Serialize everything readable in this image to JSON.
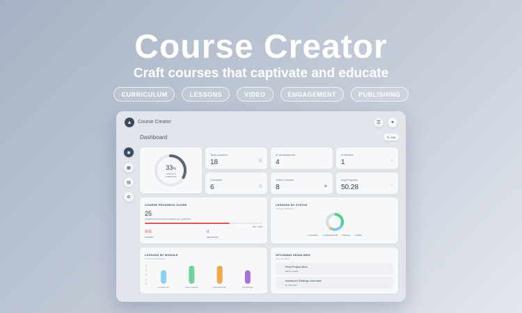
{
  "hero": {
    "title": "Course Creator",
    "subtitle": "Craft courses that captivate and educate",
    "pills": [
      "CURRICULUM",
      "LESSONS",
      "VIDEO",
      "ENGAGEMENT",
      "PUBLISHING"
    ]
  },
  "app": {
    "title": "Course Creator",
    "page_title": "Dashboard",
    "edit_label": "Edit"
  },
  "sidebar": {
    "items": [
      {
        "icon": "dashboard-icon",
        "active": true
      },
      {
        "icon": "calendar-icon",
        "active": false
      },
      {
        "icon": "calendar-grid-icon",
        "active": false
      },
      {
        "icon": "gear-icon",
        "active": false
      }
    ]
  },
  "completion": {
    "percent_display": "33",
    "percent_sign": "%",
    "label_line1": "LESSONS",
    "label_line2": "COMPLETE",
    "value": 0.33
  },
  "stats": [
    {
      "label": "Total Lessons",
      "value": "18",
      "icon": "list-icon"
    },
    {
      "label": "In Development",
      "value": "4",
      "icon": "spinner-icon"
    },
    {
      "label": "In Review",
      "value": "1",
      "icon": "search-icon"
    },
    {
      "label": "Complete",
      "value": "6",
      "icon": "check-circle-icon"
    },
    {
      "label": "Video Lessons",
      "value": "8",
      "icon": "video-icon"
    },
    {
      "label": "Avg Progress",
      "value": "50.28",
      "icon": "chart-icon"
    }
  ],
  "progress": {
    "title": "COURSE PROGRESS SCORE",
    "score": "25",
    "caption": "COMPLETION POINTS ACROSS ALL LESSONS",
    "target_label": "905 / 1250",
    "fill": 0.72,
    "earned_value": "905",
    "earned_label": "EARNED",
    "remaining_value": "0",
    "remaining_label": "REMAINING"
  },
  "status": {
    "title": "LESSONS BY STATUS",
    "subtitle": "Progress distribution",
    "legend": [
      {
        "label": "Complete",
        "color": "#4ccf8a",
        "value": 6
      },
      {
        "label": "In Development",
        "color": "#7cc7f0",
        "value": 4
      },
      {
        "label": "Review",
        "color": "#f2b84b",
        "value": 1
      },
      {
        "label": "Outline",
        "color": "#d7dbe2",
        "value": 7
      }
    ]
  },
  "modules": {
    "title": "LESSONS BY MODULE",
    "subtitle": "Curriculum breakdown",
    "y_ticks": [
      "4",
      "3",
      "2",
      "1",
      "0"
    ],
    "bars": [
      {
        "label": "Course Intro",
        "color": "#8ccff2",
        "value": 3
      },
      {
        "label": "Core Content",
        "color": "#6fd39a",
        "value": 4
      },
      {
        "label": "Advanced Top",
        "color": "#f2a64a",
        "value": 4
      },
      {
        "label": "Final Projec",
        "color": "#a873d6",
        "value": 3
      }
    ]
  },
  "deadlines": {
    "title": "UPCOMING DEADLINES",
    "subtitle": "Next due dates",
    "items": [
      {
        "title": "Final Project Brief",
        "owner": "Marcus Webb"
      },
      {
        "title": "Advanced Strategy Overview",
        "owner": "Dr. Raj Patel"
      }
    ]
  },
  "colors": {
    "accent_dark": "#3d4a5c",
    "progress_bar": "#e05a5a",
    "earned": "#e05a5a"
  }
}
